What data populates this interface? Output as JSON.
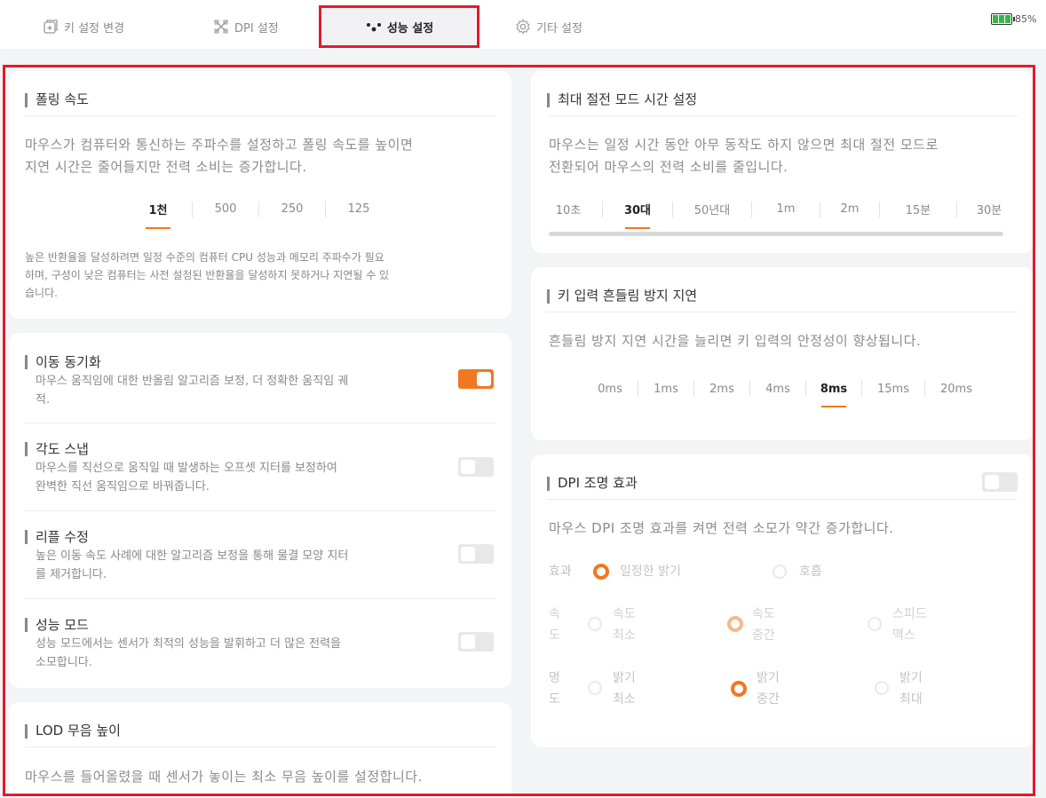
{
  "tabs": [
    {
      "label": "키 설정 변경",
      "icon": "key-settings-icon"
    },
    {
      "label": "DPI 설정",
      "icon": "dpi-icon"
    },
    {
      "label": "성능 설정",
      "icon": "performance-icon"
    },
    {
      "label": "기타 설정",
      "icon": "gear-icon"
    }
  ],
  "active_tab": "성능 설정",
  "battery": {
    "percent": "85%",
    "level": 0.85,
    "color": "#35b64a"
  },
  "polling": {
    "title": "폴링 속도",
    "desc_line1": "마우스가 컴퓨터와 통신하는 주파수를 설정하고 폴링 속도를 높이면",
    "desc_line2": "지연 시간은 줄어들지만 전력 소비는 증가합니다.",
    "options": [
      "1천",
      "500",
      "250",
      "125"
    ],
    "selected": "1천",
    "note_line1": "높은 반환율을 달성하려면 일정 수준의 컴퓨터 CPU 성능과 메모리 주파수가 필요",
    "note_line2": "하며, 구성이 낮은 컴퓨터는 사전 설정된 반환율을 달성하지 못하거나 지연될 수 있",
    "note_line3": "습니다."
  },
  "toggles": [
    {
      "title": "이동 동기화",
      "desc_line1": "마우스 움직임에 대한 반올림 알고리즘 보정, 더 정확한 움직임 궤",
      "desc_line2": "적.",
      "on": true
    },
    {
      "title": "각도 스냅",
      "desc_line1": "마우스를 직선으로 움직일 때 발생하는 오프셋 지터를 보정하여",
      "desc_line2": "완벽한 직선 움직임으로 바꿔줍니다.",
      "on": false
    },
    {
      "title": "리플 수정",
      "desc_line1": "높은 이동 속도 사례에 대한 알고리즘 보정을 통해 물결 모양 지터",
      "desc_line2": "를 제거합니다.",
      "on": false
    },
    {
      "title": "성능 모드",
      "desc_line1": "성능 모드에서는 센서가 최적의 성능을 발휘하고 더 많은 전력을",
      "desc_line2": "소모합니다.",
      "on": false
    }
  ],
  "lod": {
    "title": "LOD 무음 높이",
    "desc": "마우스를 들어올렸을 때 센서가 놓이는 최소 무음 높이를 설정합니다."
  },
  "power_save": {
    "title": "최대 절전 모드 시간 설정",
    "desc_line1": "마우스는 일정 시간 동안 아무 동작도 하지 않으면 최대 절전 모드로",
    "desc_line2": "전환되어 마우스의 전력 소비를 줄입니다.",
    "options": [
      "10초",
      "30대",
      "50년대",
      "1m",
      "2m",
      "15분",
      "30분"
    ],
    "selected": "30대"
  },
  "debounce": {
    "title": "키 입력 흔들림 방지 지연",
    "desc": "흔들림 방지 지연 시간을 늘리면 키 입력의 안정성이 향상됩니다.",
    "options": [
      "0ms",
      "1ms",
      "2ms",
      "4ms",
      "8ms",
      "15ms",
      "20ms"
    ],
    "selected": "8ms"
  },
  "dpi_light": {
    "title": "DPI 조명 효과",
    "on": false,
    "desc": "마우스 DPI 조명 효과를 켜면 전력 소모가 약간 증가합니다.",
    "effect_label": "효과",
    "effect_options": [
      "일정한 밝기",
      "호흡"
    ],
    "effect_selected": "일정한 밝기",
    "speed_label": [
      "속",
      "도"
    ],
    "speed_options": [
      [
        "속도",
        "최소"
      ],
      [
        "속도",
        "중간"
      ],
      [
        "스피드",
        "맥스"
      ]
    ],
    "speed_selected": 1,
    "bright_label": [
      "명",
      "도"
    ],
    "bright_options": [
      [
        "밝기",
        "최소"
      ],
      [
        "밝기",
        "중간"
      ],
      [
        "밝기",
        "최대"
      ]
    ],
    "bright_selected": 1
  },
  "colors": {
    "accent": "#f07820",
    "highlight": "#e21b2c",
    "battery": "#35b64a"
  }
}
